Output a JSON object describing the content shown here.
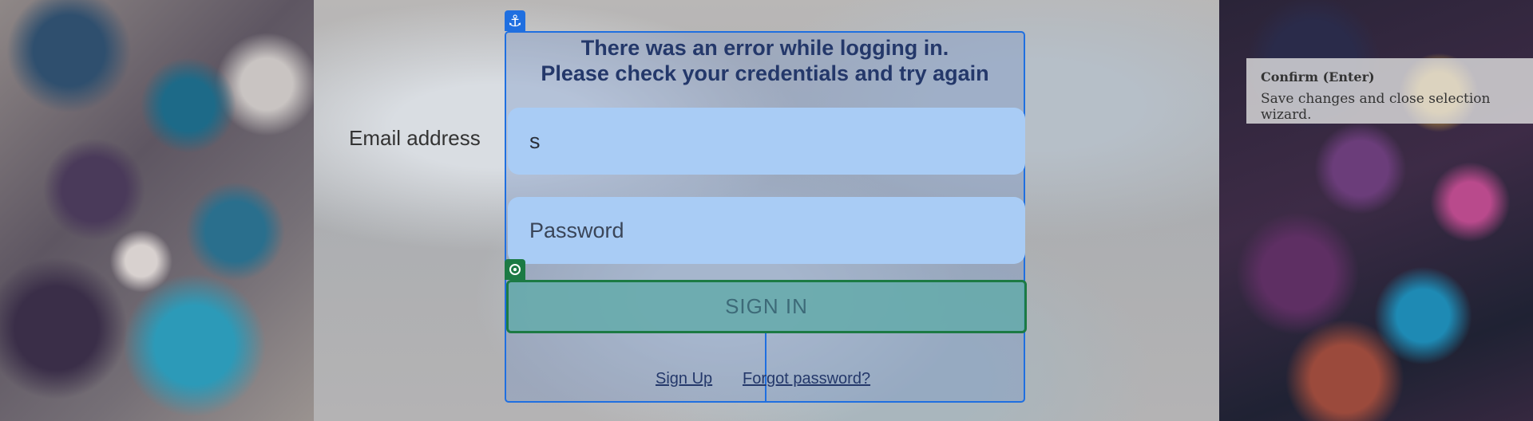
{
  "login": {
    "error_line1": "There was an error while logging in.",
    "error_line2": "Please check your credentials and try again",
    "email_label": "Email address",
    "email_value": "s",
    "password_placeholder": "Password",
    "signin_label": "SIGN IN",
    "signup_link": "Sign Up",
    "forgot_link": "Forgot password?"
  },
  "overlay": {
    "anchor_icon": "anchor-icon",
    "target_icon": "target-icon"
  },
  "tooltip": {
    "title": "Confirm (Enter)",
    "body": "Save changes and close selection wizard."
  },
  "colors": {
    "selection_blue": "#1f6fe0",
    "selection_green": "#1c7a44",
    "input_fill": "#a9ccf5"
  }
}
